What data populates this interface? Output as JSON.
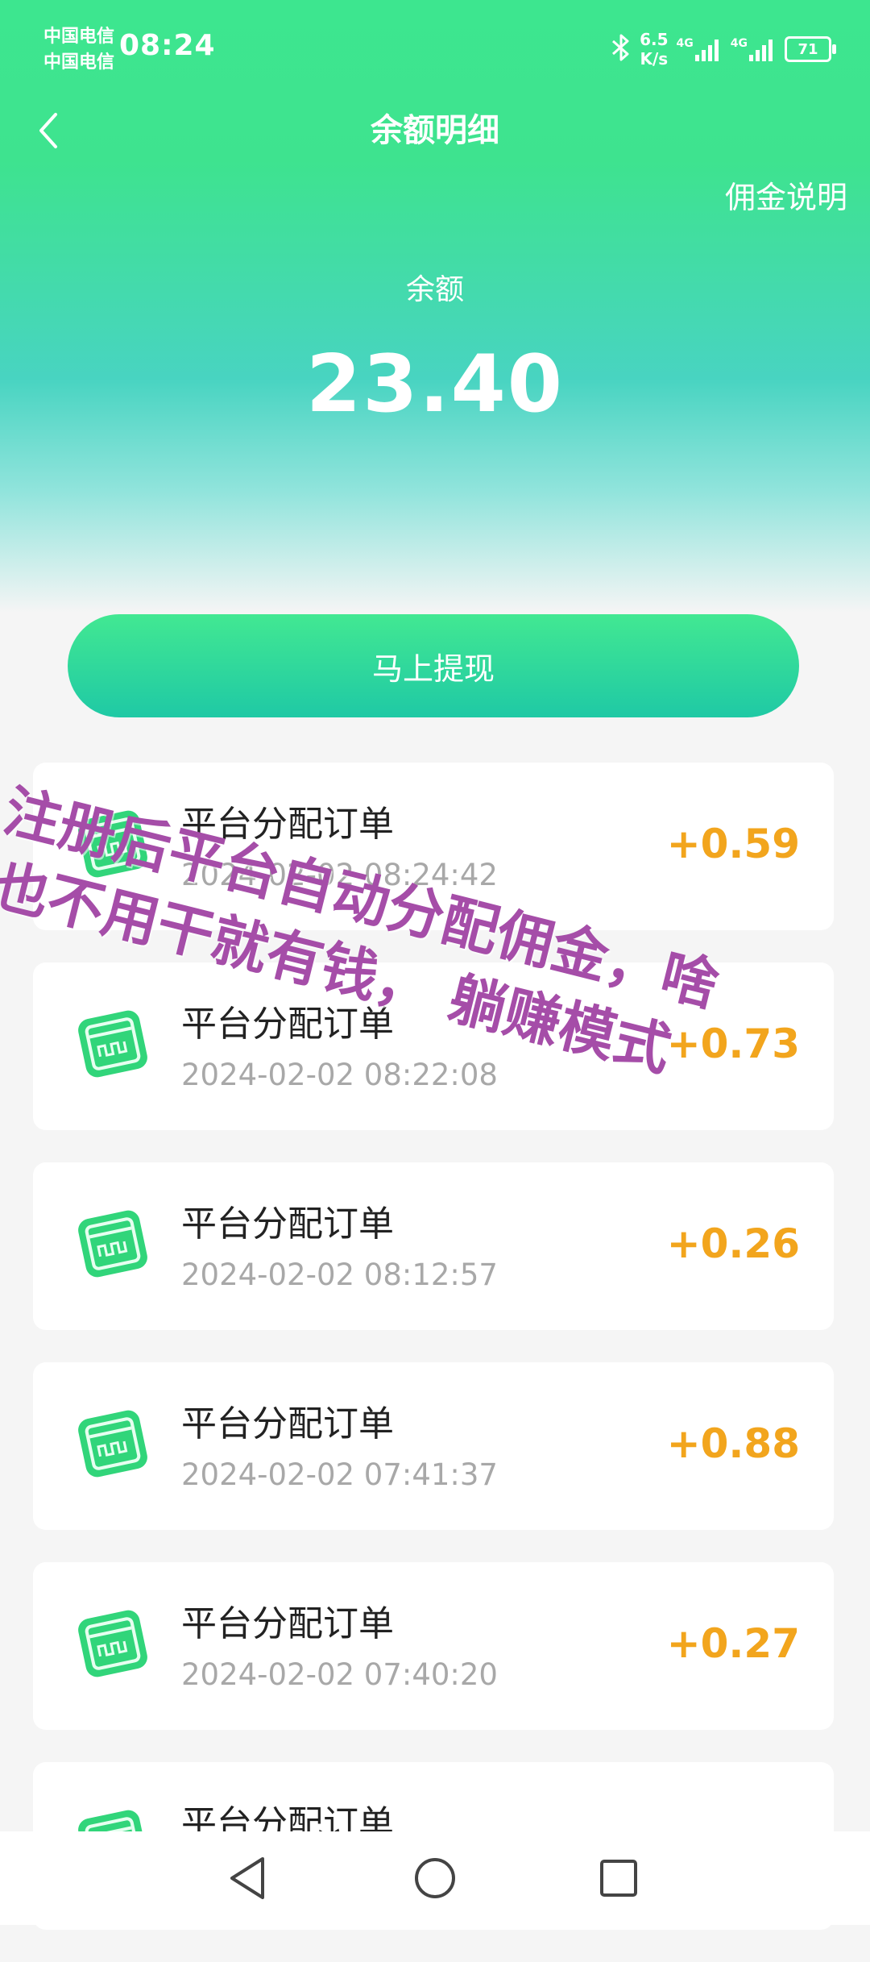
{
  "status_bar": {
    "carrier_1": "中国电信",
    "carrier_2": "中国电信",
    "time": "08:24",
    "net_speed_value": "6.5",
    "net_speed_unit": "K/s",
    "signal_1": "4G",
    "signal_2": "4G",
    "battery": "71"
  },
  "nav": {
    "title": "余额明细",
    "right_link": "佣金说明"
  },
  "balance": {
    "label": "余额",
    "value": "23.40"
  },
  "withdraw_label": "马上提现",
  "transactions": [
    {
      "title": "平台分配订单",
      "time": "2024-02-02 08:24:42",
      "amount": "+0.59"
    },
    {
      "title": "平台分配订单",
      "time": "2024-02-02 08:22:08",
      "amount": "+0.73"
    },
    {
      "title": "平台分配订单",
      "time": "2024-02-02 08:12:57",
      "amount": "+0.26"
    },
    {
      "title": "平台分配订单",
      "time": "2024-02-02 07:41:37",
      "amount": "+0.88"
    },
    {
      "title": "平台分配订单",
      "time": "2024-02-02 07:40:20",
      "amount": "+0.27"
    },
    {
      "title": "平台分配订单",
      "time": "",
      "amount": ""
    }
  ],
  "watermark": {
    "line1": "注册后平台自动分配佣金，啥",
    "line2": "也不用干就有钱，  躺赚模式"
  },
  "colors": {
    "header_green": "#3de68f",
    "header_teal": "#48d4c1",
    "amount_orange": "#f2a51d",
    "watermark_purple": "#a54da8"
  },
  "icons": {
    "back": "chevron-left-icon",
    "order": "order-receipt-icon",
    "bluetooth": "bluetooth-icon",
    "nav_back": "triangle-back-icon",
    "nav_home": "circle-home-icon",
    "nav_recents": "square-recents-icon"
  }
}
